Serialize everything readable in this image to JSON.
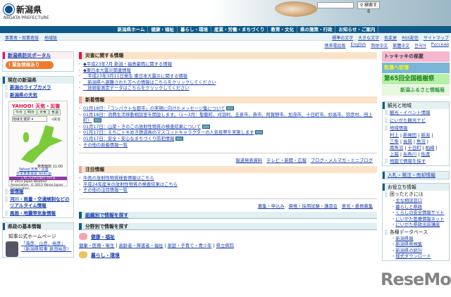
{
  "header": {
    "logo_jp": "新潟県",
    "logo_en": "NIIGATA PREFECTURE",
    "search_button": "検索する"
  },
  "nav": [
    "新潟県ホーム",
    "健康・福祉",
    "暮らし・環境",
    "産業・労働・まちづくり",
    "教育・文化",
    "県の施策・行政",
    "お知らせ・ご案内"
  ],
  "subnav_left": [
    "事業者・就業者版",
    "地域版"
  ],
  "subnav_right1": [
    "標準の文字",
    "大きな文字",
    "色変更",
    "RSS配信",
    "サイトマップ"
  ],
  "subnav_right2": [
    "携帯電話版",
    "English",
    "简体中文",
    "繁體中文",
    "한국어",
    "Русский"
  ],
  "left": {
    "bousai": {
      "title": "新潟県防災ポータル",
      "emergency": "! 緊急情報あり"
    },
    "now": {
      "title": "現在の新潟県",
      "items": [
        "新潟のライブカメラ",
        "新潟県の天気"
      ],
      "weather": {
        "logo": "YAHOO! 天気・災害",
        "tabs": [
          "今日",
          "明日",
          "天気",
          "気温"
        ],
        "select": "地域を選択",
        "back": "«戻る",
        "time": "発表時刻 11:00",
        "links": [
          "Yahoo!天気・災害",
          "日本気象協会 tenki.jp"
        ],
        "banner": "このブログに貼りつける",
        "copyright": "© 2013 Japan Weather Association. © 2013 Yahoo Japan Corporation."
      },
      "items2": [
        "雪情報",
        "河川・雨量・交通規制などのリアルタイム情報",
        "風雨・地震等気象情報"
      ]
    },
    "basic": {
      "title": "県政の基本情報",
      "governor": "知事公式ホームページ",
      "governor_link": "「海彦、山彦、裕彦」（新潟県知事 泉田裕彦）"
    }
  },
  "main": {
    "disaster": {
      "title": "災害に関する情報",
      "items": [
        "◆平成23年7月 新潟・福島豪雨に関する情報",
        "◆東日本大震災関連情報",
        "　平成23年3月11日発生 東日本大震災に関する情報",
        "　新潟県へ避難された方への情報はこちらをクリックしてください",
        "　放射能測定データはこちらをクリックしてください"
      ]
    },
    "news": {
      "title": "新着情報",
      "items": [
        "01月18日：「コンパクトな都市」の実現に向けたメッセージ集について",
        "01月18日：消費生活移動相談室を開設します。（1～3月：聖籠町、刈羽村、五泉市、燕市、阿賀野市、加茂市、十日町市、妙高市、弥彦村、田上町）",
        "01月17日：山菜・きのこの放射性物質の検査結果について",
        "01月17日：えちごトキめき鉄道㈱のマスコットキャラクターの人気投票を実施します",
        "01月17日：安全・安心なまちづくり防犯情報"
      ],
      "more": "その他の新着情報一覧",
      "links": [
        "報道発表資料",
        "テレビ・新聞・広報",
        "ブログ・メルマガ・ミニブログ"
      ]
    },
    "focus": {
      "title": "注目情報",
      "items": [
        "牛肉の放射性物質検査情報はこちら",
        "平成24年産米の放射性物質の検査結果はこちら",
        "その他の注目情報一覧"
      ],
      "links": [
        "募集・申込み",
        "資格・採用試験・講習会",
        "意見・委員募集"
      ]
    },
    "org": "組織別で情報を探す",
    "field": {
      "title": "分野別で情報を探す",
      "cat1": "健康・福祉",
      "cat1_links": [
        "健康・医療・衛生",
        "高齢者・障害者・福祉",
        "家庭・子育て・青少年",
        "県立病院"
      ],
      "cat2": "暮らし・環境"
    }
  },
  "right": {
    "banners": [
      "トッキッキの部屋",
      "佐渡へ空港",
      "第65回全国植樹祭",
      "新潟ふるさと情報局"
    ],
    "tourism": {
      "title": "観光と地域",
      "items": [
        "観光・イベント情報",
        "にいがた観光ナビ",
        "地域情報"
      ],
      "cities": [
        "村上",
        "新発田",
        "新潟",
        "三条",
        "長岡",
        "魚沼",
        "南魚沼",
        "十日町",
        "柏崎",
        "上越",
        "糸魚川",
        "佐渡"
      ],
      "map": "地図で情報を探す"
    },
    "bid": "入札・発注・売却情報",
    "useful": {
      "title": "お役立ち情報",
      "trouble": "困ったときには",
      "trouble_items": [
        "主な相談窓口",
        "暮らしと県政",
        "くらしの安全情報サイト",
        "にいがた医療情報ネット",
        "にいがた県政出前講座"
      ],
      "db": "各種データベース",
      "db_items": [
        "新潟県報",
        "新潟県例規集",
        "新潟県の統計",
        "様式ダウンロード"
      ]
    }
  },
  "watermark": "ReseMom"
}
